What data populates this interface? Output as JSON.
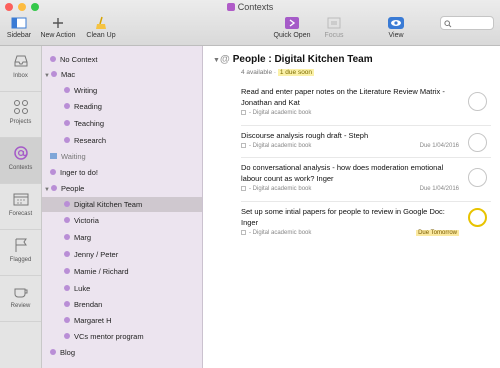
{
  "window": {
    "title": "Contexts",
    "title_icon": "contexts-icon",
    "lights": [
      "#fc605c",
      "#fdbc40",
      "#34c84a"
    ]
  },
  "toolbar": {
    "sidebar_label": "Sidebar",
    "new_action_label": "New Action",
    "clean_up_label": "Clean Up",
    "quick_open_label": "Quick Open",
    "focus_label": "Focus",
    "view_label": "View"
  },
  "perspectives": [
    {
      "label": "Inbox",
      "icon": "inbox-icon"
    },
    {
      "label": "Projects",
      "icon": "projects-icon"
    },
    {
      "label": "Contexts",
      "icon": "contexts-icon"
    },
    {
      "label": "Forecast",
      "icon": "forecast-icon"
    },
    {
      "label": "Flagged",
      "icon": "flag-icon"
    },
    {
      "label": "Review",
      "icon": "review-icon"
    }
  ],
  "contexts": [
    {
      "label": "No Context"
    },
    {
      "label": "Mac"
    },
    {
      "label": "Writing"
    },
    {
      "label": "Reading"
    },
    {
      "label": "Teaching"
    },
    {
      "label": "Research"
    },
    {
      "label": "Waiting"
    },
    {
      "label": "Inger to do!"
    },
    {
      "label": "People"
    },
    {
      "label": "Digital Kitchen Team"
    },
    {
      "label": "Victoria"
    },
    {
      "label": "Marg"
    },
    {
      "label": "Jenny / Peter"
    },
    {
      "label": "Mamie / Richard"
    },
    {
      "label": "Luke"
    },
    {
      "label": "Brendan"
    },
    {
      "label": "Margaret H"
    },
    {
      "label": "VCs mentor program"
    },
    {
      "label": "Blog"
    }
  ],
  "main": {
    "header": {
      "at_symbol": "@",
      "title": "People : Digital Kitchen Team",
      "available": "4 available ·",
      "due_soon": "1 due soon"
    },
    "tasks": [
      {
        "title": "Read and enter paper notes on the Literature Review Matrix - Jonathan and Kat",
        "project": "- Digital academic book",
        "due": ""
      },
      {
        "title": "Discourse analysis rough draft - Steph",
        "project": "- Digital academic book",
        "due": "Due 1/04/2016"
      },
      {
        "title": "Do conversational analysis - how does moderation emotional labour count as work? Inger",
        "project": "- Digital academic book",
        "due": "Due 1/04/2016"
      },
      {
        "title": "Set up some intial papers for people to review in Google Doc: Inger",
        "project": "- Digital academic book",
        "due": "Due Tomorrow"
      }
    ]
  },
  "colors": {
    "accent": "#a55bc8",
    "due_soon_highlight": "#fbf1a8",
    "context_dot": "#b98ed6",
    "due_circle": "#e8c300"
  }
}
